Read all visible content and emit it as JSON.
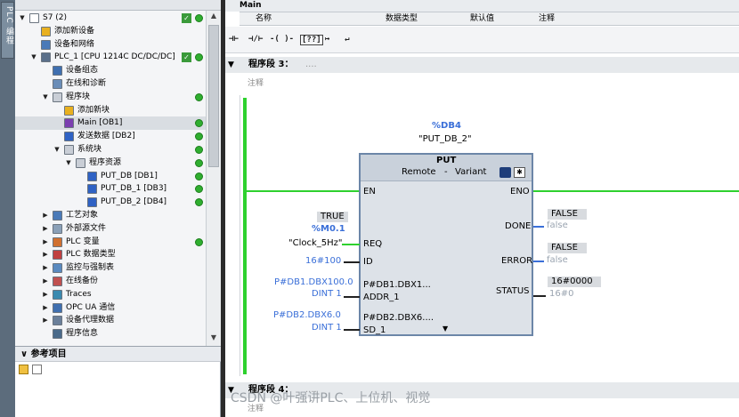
{
  "side_tab": "PLC 编程",
  "tree": [
    {
      "label": "S7 (2)",
      "indent": 0,
      "arrow": "▼",
      "icon": "file-icon",
      "status": true
    },
    {
      "label": "添加新设备",
      "indent": 1,
      "arrow": "",
      "icon": "add-device-icon",
      "status": false
    },
    {
      "label": "设备和网络",
      "indent": 1,
      "arrow": "",
      "icon": "network-icon",
      "status": false
    },
    {
      "label": "PLC_1 [CPU 1214C DC/DC/DC]",
      "indent": 1,
      "arrow": "▼",
      "icon": "cpu-icon",
      "status": true
    },
    {
      "label": "设备组态",
      "indent": 2,
      "arrow": "",
      "icon": "device-config-icon",
      "status": false
    },
    {
      "label": "在线和诊断",
      "indent": 2,
      "arrow": "",
      "icon": "diagnostics-icon",
      "status": false
    },
    {
      "label": "程序块",
      "indent": 2,
      "arrow": "▼",
      "icon": "folder-icon",
      "status": false,
      "dot": true
    },
    {
      "label": "添加新块",
      "indent": 3,
      "arrow": "",
      "icon": "add-block-icon",
      "status": false
    },
    {
      "label": "Main [OB1]",
      "indent": 3,
      "arrow": "",
      "icon": "ob-icon",
      "status": false,
      "dot": true,
      "selected": true
    },
    {
      "label": "发送数据 [DB2]",
      "indent": 3,
      "arrow": "",
      "icon": "db-icon",
      "status": false,
      "dot": true
    },
    {
      "label": "系统块",
      "indent": 3,
      "arrow": "▼",
      "icon": "folder-icon",
      "status": false,
      "dot": true
    },
    {
      "label": "程序资源",
      "indent": 4,
      "arrow": "▼",
      "icon": "folder-icon",
      "status": false,
      "dot": true
    },
    {
      "label": "PUT_DB [DB1]",
      "indent": 5,
      "arrow": "",
      "icon": "db-icon",
      "status": false,
      "dot": true
    },
    {
      "label": "PUT_DB_1 [DB3]",
      "indent": 5,
      "arrow": "",
      "icon": "db-icon",
      "status": false,
      "dot": true
    },
    {
      "label": "PUT_DB_2 [DB4]",
      "indent": 5,
      "arrow": "",
      "icon": "db-icon",
      "status": false,
      "dot": true
    },
    {
      "label": "工艺对象",
      "indent": 2,
      "arrow": "▶",
      "icon": "tech-object-icon",
      "status": false
    },
    {
      "label": "外部源文件",
      "indent": 2,
      "arrow": "▶",
      "icon": "external-source-icon",
      "status": false
    },
    {
      "label": "PLC 变量",
      "indent": 2,
      "arrow": "▶",
      "icon": "plc-tags-icon",
      "status": false,
      "dot": true
    },
    {
      "label": "PLC 数据类型",
      "indent": 2,
      "arrow": "▶",
      "icon": "data-type-icon",
      "status": false
    },
    {
      "label": "监控与强制表",
      "indent": 2,
      "arrow": "▶",
      "icon": "watch-table-icon",
      "status": false
    },
    {
      "label": "在线备份",
      "indent": 2,
      "arrow": "▶",
      "icon": "backup-icon",
      "status": false
    },
    {
      "label": "Traces",
      "indent": 2,
      "arrow": "▶",
      "icon": "traces-icon",
      "status": false
    },
    {
      "label": "OPC UA 通信",
      "indent": 2,
      "arrow": "▶",
      "icon": "opcua-icon",
      "status": false
    },
    {
      "label": "设备代理数据",
      "indent": 2,
      "arrow": "▶",
      "icon": "proxy-data-icon",
      "status": false
    },
    {
      "label": "程序信息",
      "indent": 2,
      "arrow": "",
      "icon": "program-info-icon",
      "status": false
    }
  ],
  "ref_panel": {
    "title": "参考项目"
  },
  "editor": {
    "block_title": "Main",
    "columns": [
      "名称",
      "数据类型",
      "默认值",
      "注释"
    ],
    "toolbar": [
      "⊣⊢",
      "⊣/⊢",
      "-( )-",
      "[??]",
      "↦",
      "↵"
    ],
    "network3": {
      "title": "程序段 3：",
      "dots": "....",
      "comment": "注释"
    },
    "network4": {
      "title": "程序段 4：",
      "dots": "....",
      "comment": "注释"
    }
  },
  "fb": {
    "instance_addr": "%DB4",
    "instance_name": "\"PUT_DB_2\"",
    "name": "PUT",
    "mode_left": "Remote",
    "mode_sep": "-",
    "mode_right": "Variant",
    "pin_en": "EN",
    "pin_eno": "ENO",
    "pin_req": "REQ",
    "pin_id": "ID",
    "pin_addr1": "ADDR_1",
    "pin_sd1": "SD_1",
    "pin_done": "DONE",
    "pin_error": "ERROR",
    "pin_status": "STATUS",
    "addr1_inner": "P#DB1.DBX1...",
    "sd1_inner": "P#DB2.DBX6....",
    "expand": "▼"
  },
  "params": {
    "req_monitor": "TRUE",
    "req_addr": "%M0.1",
    "req_name": "\"Clock_5Hz\"",
    "id_value": "16#100",
    "addr1_value": "P#DB1.DBX100.0",
    "addr1_type": "DINT 1",
    "sd1_value": "P#DB2.DBX6.0",
    "sd1_type": "DINT 1",
    "done_monitor": "FALSE",
    "done_value": "false",
    "error_monitor": "FALSE",
    "error_value": "false",
    "status_monitor": "16#0000",
    "status_value": "16#0"
  },
  "watermark": "CSDN @叶强讲PLC、上位机、视觉",
  "colors": {
    "power_flow": "#2ed12e",
    "accent_blue": "#3a6fd8",
    "status_ok": "#2fae2f"
  }
}
